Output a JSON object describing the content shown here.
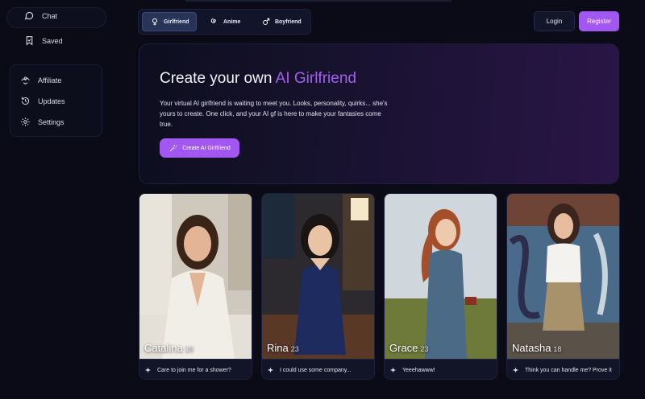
{
  "sidebar": {
    "items": [
      {
        "label": "Chat",
        "icon": "chat-bubble-icon"
      },
      {
        "label": "Saved",
        "icon": "bookmark-icon"
      },
      {
        "label": "Affiliate",
        "icon": "affiliate-icon"
      },
      {
        "label": "Updates",
        "icon": "updates-icon"
      },
      {
        "label": "Settings",
        "icon": "gear-icon"
      }
    ]
  },
  "tabs": [
    {
      "label": "Girlfriend",
      "icon": "female-symbol-icon",
      "active": true
    },
    {
      "label": "Anime",
      "icon": "anime-swirl-icon",
      "active": false
    },
    {
      "label": "Boyfriend",
      "icon": "male-symbol-icon",
      "active": false
    }
  ],
  "header": {
    "login_label": "Login",
    "register_label": "Register"
  },
  "hero": {
    "title_main": "Create your own ",
    "title_accent": "AI Girlfriend",
    "description": "Your virtual AI girlfriend is waiting to meet you. Looks, personality, quirks... she's yours to create. One click, and your AI gf is here to make your fantasies come true.",
    "cta_label": "Create AI Girlfriend"
  },
  "cards": [
    {
      "name": "Catalina",
      "age": "19",
      "message": "Care to join me for a shower?"
    },
    {
      "name": "Rina",
      "age": "23",
      "message": "I could use some company..."
    },
    {
      "name": "Grace",
      "age": "23",
      "message": "Yeeehawww!"
    },
    {
      "name": "Natasha",
      "age": "18",
      "message": "Think you can handle me? Prove it"
    }
  ],
  "colors": {
    "background": "#0a0b17",
    "accent": "#a258f0",
    "active_tab": "#283457"
  }
}
